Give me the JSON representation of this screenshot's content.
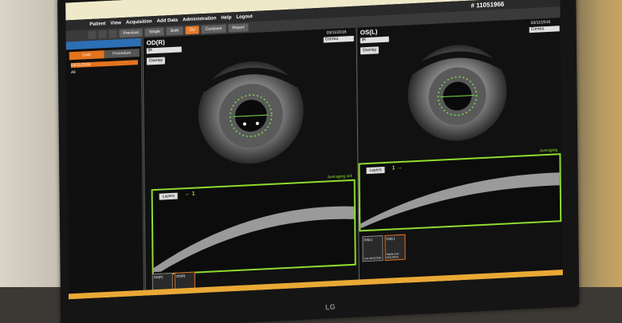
{
  "menu": [
    "Patient",
    "View",
    "Acquisition",
    "Add Data",
    "Administration",
    "Help",
    "Logout"
  ],
  "patient_id": "# 11051966",
  "toolbar": [
    "",
    "",
    "",
    "Previous",
    "Single",
    "Both",
    "OU",
    "Compare",
    "Report"
  ],
  "left_panel": {
    "tabs": [
      "Date",
      "Procedure"
    ],
    "rows": [
      "03/11/2016",
      "All"
    ]
  },
  "od": {
    "title": "OD(R)",
    "date": "03/11/2016",
    "mode": "IR",
    "view": "Cornea",
    "overlay": "Overlay",
    "averaging": "Averaging 4/4",
    "layers": "Layers",
    "arrow": "← 1",
    "thumbs": [
      {
        "label": "OD(R)",
        "sub": "Line 03/11/2016"
      },
      {
        "label": "OD(R)",
        "sub": "Radial scan 03/11/2016"
      }
    ]
  },
  "os": {
    "title": "OS(L)",
    "date": "03/11/2016",
    "mode": "IR",
    "view": "Cornea",
    "overlay": "Overlay",
    "averaging": "Averaging",
    "layers": "Layers",
    "arrow": "1 →",
    "thumbs": [
      {
        "label": "OS(L)",
        "sub": "Line 03/11/2016"
      },
      {
        "label": "OS(L)",
        "sub": "Radial scan 03/11/2016"
      }
    ]
  },
  "brand": "LG",
  "colors": {
    "accent": "#e5731e",
    "scan_frame": "#8fdc2f",
    "titlebar": "#efe9c9"
  }
}
